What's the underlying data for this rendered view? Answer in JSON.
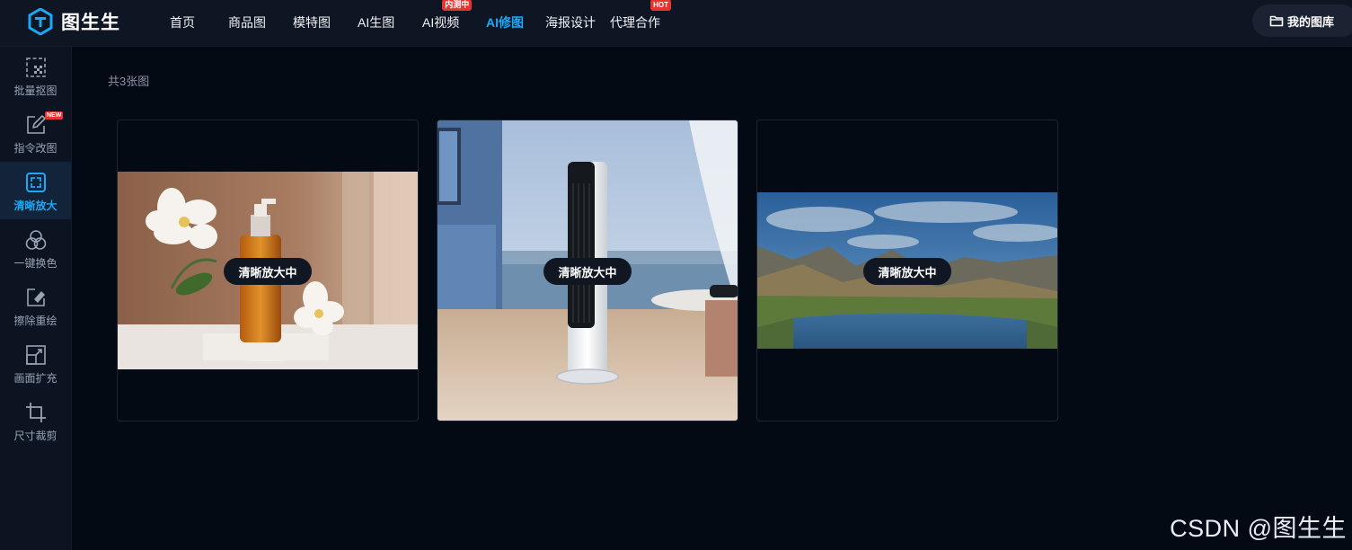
{
  "brand": {
    "name": "图生生"
  },
  "nav": {
    "items": [
      {
        "label": "首页",
        "active": false,
        "badge": ""
      },
      {
        "label": "商品图",
        "active": false,
        "badge": ""
      },
      {
        "label": "模特图",
        "active": false,
        "badge": ""
      },
      {
        "label": "AI生图",
        "active": false,
        "badge": ""
      },
      {
        "label": "AI视频",
        "active": false,
        "badge": "内测中"
      },
      {
        "label": "AI修图",
        "active": true,
        "badge": ""
      },
      {
        "label": "海报设计",
        "active": false,
        "badge": ""
      },
      {
        "label": "代理合作",
        "active": false,
        "badge": "HOT"
      }
    ],
    "gallery_label": "我的图库"
  },
  "sidebar": {
    "items": [
      {
        "label": "批量抠图",
        "icon": "batch-cutout-icon",
        "active": false
      },
      {
        "label": "指令改图",
        "icon": "edit-pen-icon",
        "active": false,
        "badge": "NEW"
      },
      {
        "label": "清晰放大",
        "icon": "upscale-frame-icon",
        "active": true
      },
      {
        "label": "一键换色",
        "icon": "color-circles-icon",
        "active": false
      },
      {
        "label": "擦除重绘",
        "icon": "eraser-icon",
        "active": false
      },
      {
        "label": "画面扩充",
        "icon": "expand-canvas-icon",
        "active": false
      },
      {
        "label": "尺寸裁剪",
        "icon": "crop-icon",
        "active": false
      }
    ]
  },
  "main": {
    "count_text": "共3张图",
    "cards": [
      {
        "status": "清晰放大中",
        "subject": "skincare-bottle-flowers"
      },
      {
        "status": "清晰放大中",
        "subject": "tower-fan-living-room"
      },
      {
        "status": "清晰放大中",
        "subject": "mountain-lake-landscape"
      }
    ]
  },
  "watermark": "CSDN @图生生",
  "colors": {
    "accent": "#1ba8f5",
    "badge": "#e8342f",
    "background": "#040a14",
    "topbar": "#0e1624"
  }
}
